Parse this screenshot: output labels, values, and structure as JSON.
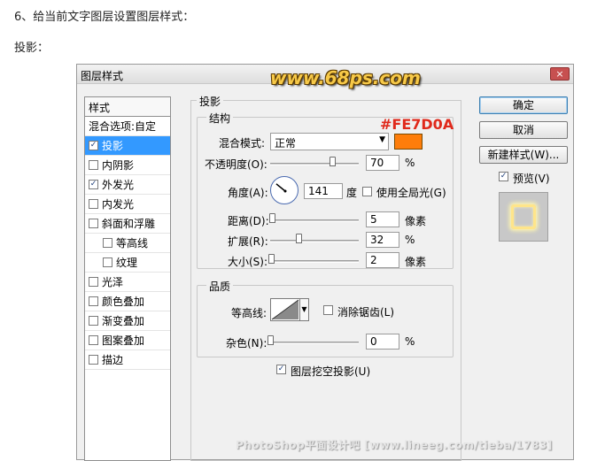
{
  "article": {
    "step_text": "6、给当前文字图层设置图层样式：",
    "section_label": "投影："
  },
  "dialog": {
    "title": "图层样式",
    "close_label": "×",
    "logo_text": "www.68ps.com"
  },
  "styles": {
    "header": "样式",
    "blend_options": "混合选项:自定",
    "items": [
      {
        "label": "投影",
        "checked": true,
        "selected": true,
        "indent": false
      },
      {
        "label": "内阴影",
        "checked": false,
        "selected": false,
        "indent": false
      },
      {
        "label": "外发光",
        "checked": true,
        "selected": false,
        "indent": false
      },
      {
        "label": "内发光",
        "checked": false,
        "selected": false,
        "indent": false
      },
      {
        "label": "斜面和浮雕",
        "checked": false,
        "selected": false,
        "indent": false
      },
      {
        "label": "等高线",
        "checked": false,
        "selected": false,
        "indent": true
      },
      {
        "label": "纹理",
        "checked": false,
        "selected": false,
        "indent": true
      },
      {
        "label": "光泽",
        "checked": false,
        "selected": false,
        "indent": false
      },
      {
        "label": "颜色叠加",
        "checked": false,
        "selected": false,
        "indent": false
      },
      {
        "label": "渐变叠加",
        "checked": false,
        "selected": false,
        "indent": false
      },
      {
        "label": "图案叠加",
        "checked": false,
        "selected": false,
        "indent": false
      },
      {
        "label": "描边",
        "checked": false,
        "selected": false,
        "indent": false
      }
    ]
  },
  "drop_shadow": {
    "legend": "投影",
    "structure": {
      "legend": "结构",
      "hex_annotation": "#FE7D0A",
      "color": "#FE7D0A",
      "blend_mode_label": "混合模式:",
      "blend_mode_value": "正常",
      "opacity_label": "不透明度(O):",
      "opacity_value": "70",
      "opacity_unit": "%",
      "opacity_fraction": 0.7,
      "angle_label": "角度(A):",
      "angle_value": "141",
      "angle_unit": "度",
      "global_light_label": "使用全局光(G)",
      "global_light_checked": false,
      "distance_label": "距离(D):",
      "distance_value": "5",
      "distance_unit": "像素",
      "distance_fraction": 0.02,
      "spread_label": "扩展(R):",
      "spread_value": "32",
      "spread_unit": "%",
      "spread_fraction": 0.32,
      "size_label": "大小(S):",
      "size_value": "2",
      "size_unit": "像素",
      "size_fraction": 0.01
    },
    "quality": {
      "legend": "品质",
      "contour_label": "等高线:",
      "antialias_label": "消除锯齿(L)",
      "antialias_checked": false,
      "noise_label": "杂色(N):",
      "noise_value": "0",
      "noise_unit": "%",
      "noise_fraction": 0.0
    },
    "knockout_label": "图层挖空投影(U)",
    "knockout_checked": true
  },
  "buttons": {
    "ok": "确定",
    "cancel": "取消",
    "new_style": "新建样式(W)...",
    "preview_label": "预览(V)",
    "preview_checked": true
  },
  "watermark": "PhotoShop平面设计吧 [www.lineeg.com/tieba/1783]"
}
